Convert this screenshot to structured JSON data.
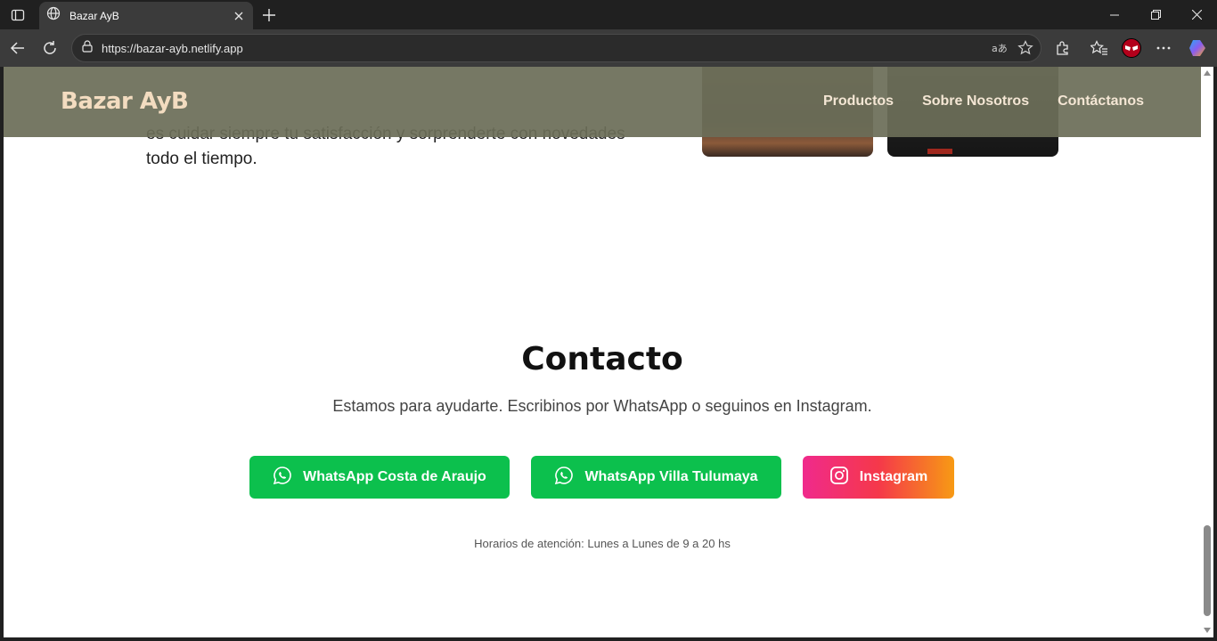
{
  "browser": {
    "tab_title": "Bazar AyB",
    "url": "https://bazar-ayb.netlify.app"
  },
  "site": {
    "logo": "Bazar AyB",
    "nav": [
      "Productos",
      "Sobre Nosotros",
      "Contáctanos"
    ]
  },
  "about": {
    "text_line1": "es cuidar siempre tu satisfacción y sorprenderte con novedades",
    "text_line2": "todo el tiempo."
  },
  "contact": {
    "title": "Contacto",
    "subtitle": "Estamos para ayudarte. Escribinos por WhatsApp o seguinos en Instagram.",
    "buttons": {
      "wa1": "WhatsApp Costa de Araujo",
      "wa2": "WhatsApp Villa Tulumaya",
      "ig": "Instagram"
    },
    "hours": "Horarios de atención: Lunes a Lunes de 9 a 20 hs"
  },
  "colors": {
    "whatsapp_green": "#0cc04d",
    "header_bg": "#6c6e58",
    "logo_color": "#f3dcc0"
  }
}
